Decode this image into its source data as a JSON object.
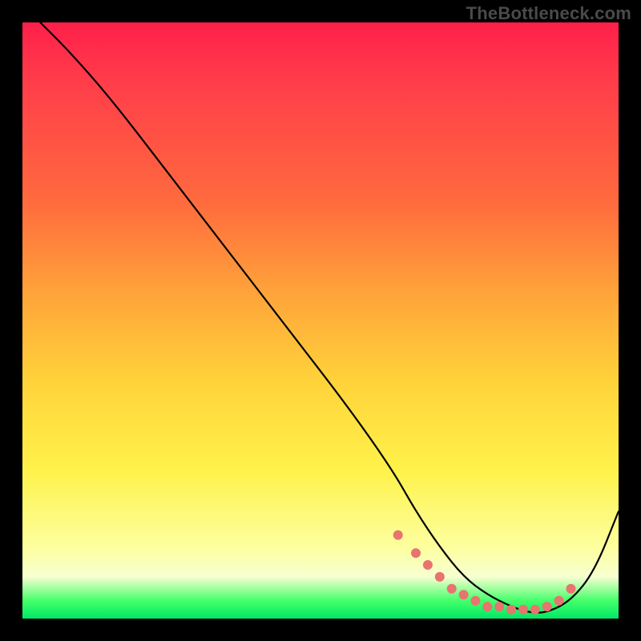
{
  "watermark": "TheBottleneck.com",
  "chart_data": {
    "type": "line",
    "title": "",
    "xlabel": "",
    "ylabel": "",
    "xlim": [
      0,
      100
    ],
    "ylim": [
      0,
      100
    ],
    "series": [
      {
        "name": "bottleneck-curve",
        "x": [
          3,
          8,
          15,
          25,
          35,
          45,
          55,
          62,
          66,
          70,
          74,
          78,
          82,
          85,
          88,
          92,
          96,
          100
        ],
        "y": [
          100,
          95,
          87,
          74,
          61,
          48,
          35,
          25,
          18,
          12,
          7,
          4,
          2,
          1,
          1,
          3,
          8,
          18
        ]
      }
    ],
    "markers": {
      "name": "highlight-dots",
      "color": "#e9736f",
      "x": [
        63,
        66,
        68,
        70,
        72,
        74,
        76,
        78,
        80,
        82,
        84,
        86,
        88,
        90,
        92
      ],
      "y": [
        14,
        11,
        9,
        7,
        5,
        4,
        3,
        2,
        2,
        1.5,
        1.5,
        1.5,
        2,
        3,
        5
      ]
    },
    "background_gradient": {
      "stops": [
        {
          "pct": 0,
          "color": "#ff1f4a"
        },
        {
          "pct": 30,
          "color": "#ff6a3e"
        },
        {
          "pct": 60,
          "color": "#ffd23a"
        },
        {
          "pct": 88,
          "color": "#fdff9e"
        },
        {
          "pct": 100,
          "color": "#00e865"
        }
      ]
    }
  }
}
